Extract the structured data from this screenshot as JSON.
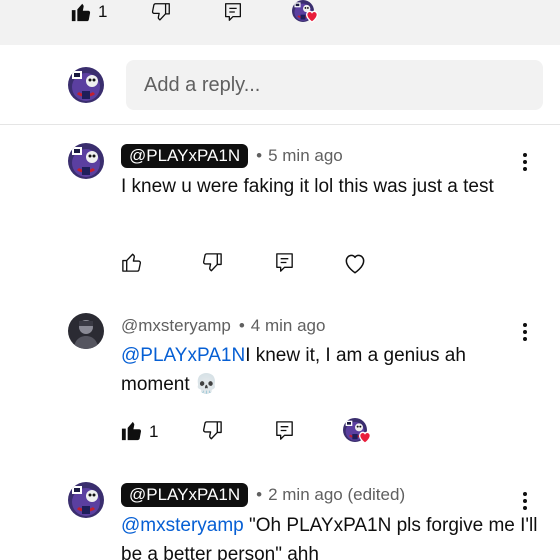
{
  "top_actions": {
    "like_count": "1"
  },
  "reply_box": {
    "placeholder": "Add a reply..."
  },
  "comments": [
    {
      "author": "@PLAYxPA1N",
      "author_style": "chip",
      "time": "5 min ago",
      "text": "I knew u were faking it lol this was just a test"
    },
    {
      "author": "@mxsteryamp",
      "author_style": "plain",
      "time": "4 min ago",
      "mention": "@PLAYxPA1N",
      "text": "I knew it, I am a genius ah moment 💀",
      "like_count": "1"
    },
    {
      "author": "@PLAYxPA1N",
      "author_style": "chip",
      "time": "2 min ago (edited)",
      "mention": "@mxsteryamp",
      "text": " \"Oh PLAYxPA1N pls forgive me I'll be a better person\" ahh"
    }
  ],
  "icons": [
    "thumb-up-filled-icon",
    "thumb-up-outline-icon",
    "thumb-down-icon",
    "reply-icon",
    "heart-outline-icon",
    "creator-heart-icon",
    "more-vert-icon"
  ],
  "colors": {
    "mention": "#065fd4",
    "chip_bg": "#0f0f0f",
    "heart": "#e91e3c",
    "muted": "#606060"
  }
}
